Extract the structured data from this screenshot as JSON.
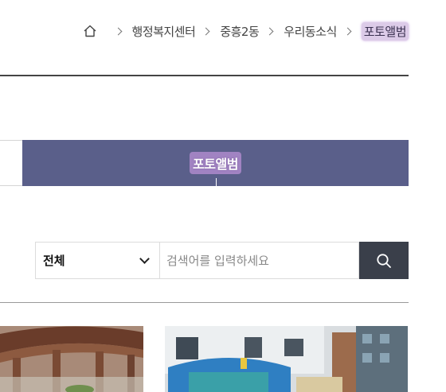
{
  "breadcrumb": {
    "items": [
      "행정복지센터",
      "중흥2동",
      "우리동소식",
      "포토앨범"
    ]
  },
  "tab": {
    "active_label": "포토앨범"
  },
  "search": {
    "category_selected": "전체",
    "placeholder": "검색어를 입력하세요"
  },
  "colors": {
    "tab_active_bg": "#5a5f8a",
    "search_button_bg": "#3a3f4a"
  },
  "icons": {
    "home": "home-icon",
    "separator": "chevron-right-icon",
    "dropdown": "chevron-down-icon",
    "search": "search-icon"
  }
}
